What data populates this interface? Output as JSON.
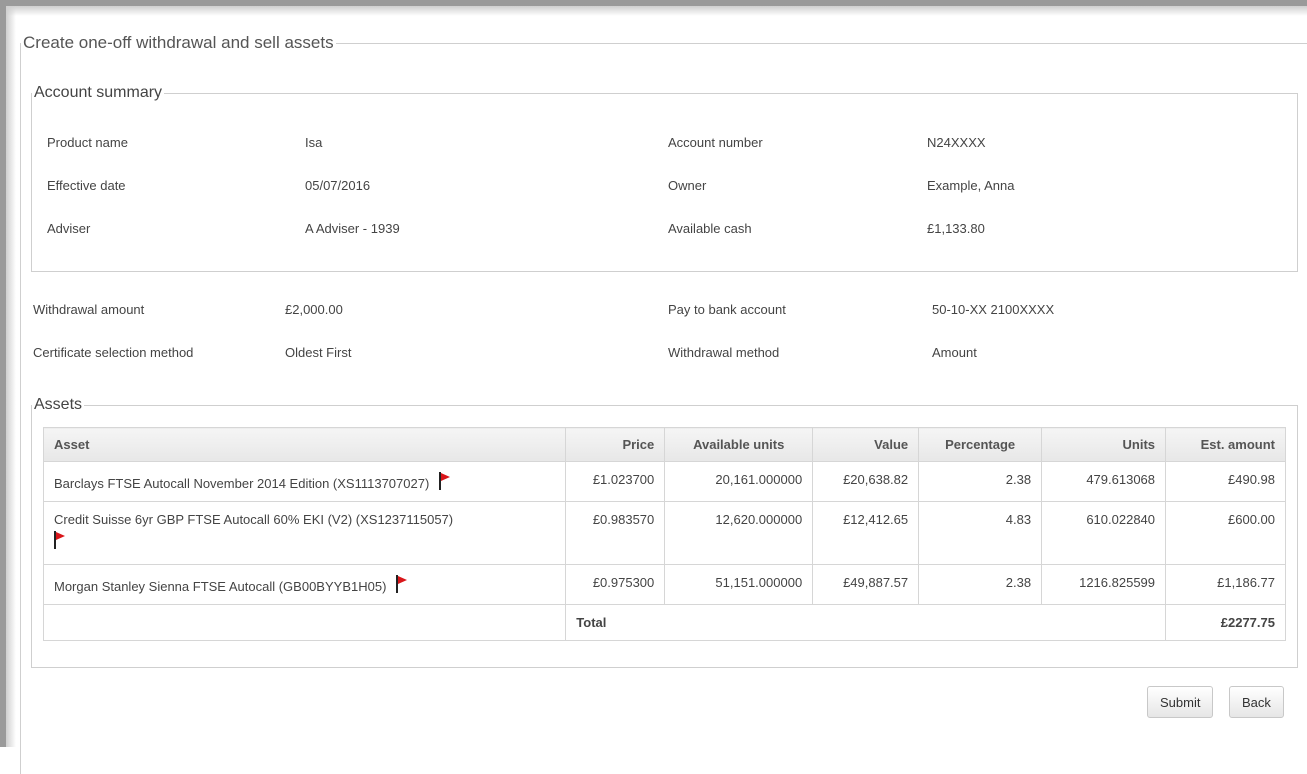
{
  "page": {
    "title": "Create one-off withdrawal and sell assets"
  },
  "account_summary": {
    "legend": "Account summary",
    "product_name_label": "Product name",
    "product_name": "Isa",
    "effective_date_label": "Effective date",
    "effective_date": "05/07/2016",
    "adviser_label": "Adviser",
    "adviser": "A Adviser - 1939",
    "account_number_label": "Account number",
    "account_number": "N24XXXX",
    "owner_label": "Owner",
    "owner": "Example, Anna",
    "available_cash_label": "Available cash",
    "available_cash": "£1,133.80"
  },
  "withdrawal": {
    "amount_label": "Withdrawal amount",
    "amount": "£2,000.00",
    "cert_method_label": "Certificate selection method",
    "cert_method": "Oldest First",
    "bank_label": "Pay to bank account",
    "bank": "50-10-XX 2100XXXX",
    "method_label": "Withdrawal method",
    "method": "Amount"
  },
  "assets": {
    "legend": "Assets",
    "headers": [
      "Asset",
      "Price",
      "Available units",
      "Value",
      "Percentage",
      "Units",
      "Est. amount"
    ],
    "rows": [
      {
        "asset": "Barclays FTSE Autocall November 2014 Edition  (XS1113707027)",
        "price": "£1.023700",
        "available_units": "20,161.000000",
        "value": "£20,638.82",
        "percentage": "2.38",
        "units": "479.613068",
        "est_amount": "£490.98"
      },
      {
        "asset": "Credit Suisse 6yr GBP FTSE Autocall 60% EKI (V2)  (XS1237115057)",
        "price": "£0.983570",
        "available_units": "12,620.000000",
        "value": "£12,412.65",
        "percentage": "4.83",
        "units": "610.022840",
        "est_amount": "£600.00"
      },
      {
        "asset": "Morgan Stanley Sienna FTSE Autocall  (GB00BYYB1H05)",
        "price": "£0.975300",
        "available_units": "51,151.000000",
        "value": "£49,887.57",
        "percentage": "2.38",
        "units": "1216.825599",
        "est_amount": "£1,186.77"
      }
    ],
    "total_label": "Total",
    "total_amount": "£2277.75"
  },
  "buttons": {
    "submit": "Submit",
    "back": "Back"
  },
  "icons": {
    "flag": "red-flag-icon",
    "flag_color": "#d9161a"
  }
}
